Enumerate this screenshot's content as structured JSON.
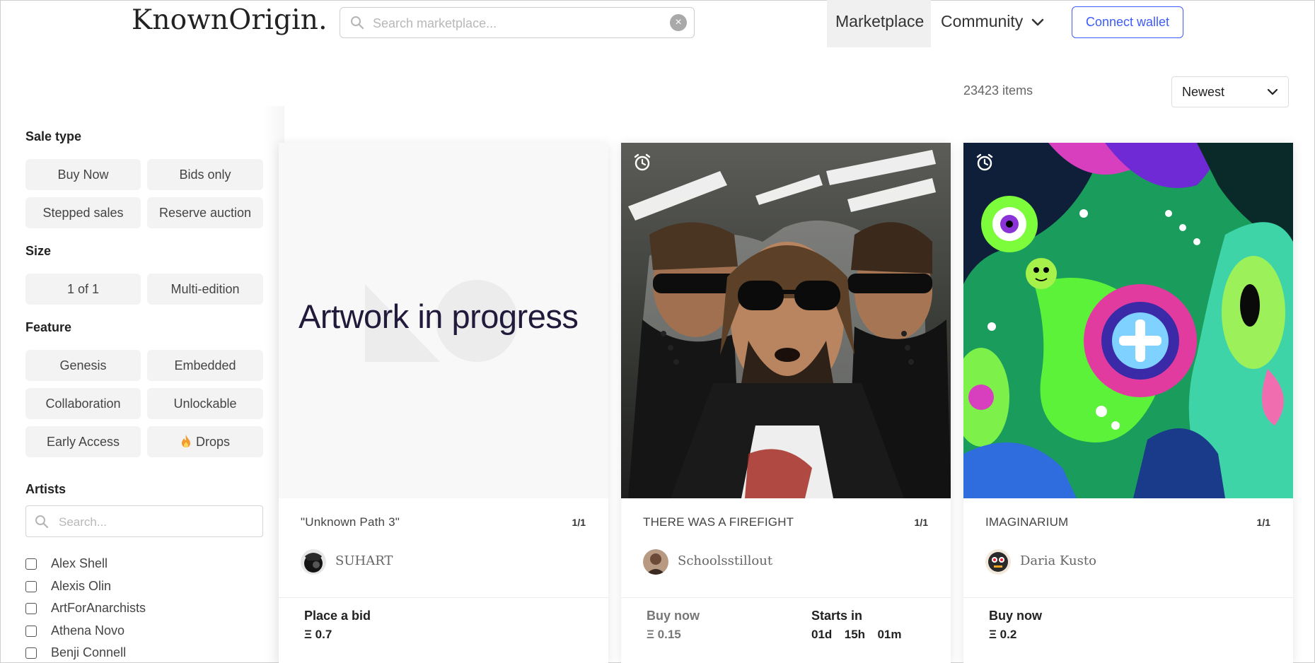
{
  "header": {
    "logo": "KnownOrigin.",
    "search_placeholder": "Search marketplace...",
    "nav_marketplace": "Marketplace",
    "nav_community": "Community",
    "connect_wallet": "Connect wallet"
  },
  "results": {
    "count": "23423 items",
    "sort_selected": "Newest"
  },
  "sidebar": {
    "sale_type": {
      "title": "Sale type",
      "options": [
        "Buy Now",
        "Bids only",
        "Stepped sales",
        "Reserve auction"
      ]
    },
    "size": {
      "title": "Size",
      "options": [
        "1 of 1",
        "Multi-edition"
      ]
    },
    "feature": {
      "title": "Feature",
      "options": [
        "Genesis",
        "Embedded",
        "Collaboration",
        "Unlockable",
        "Early Access",
        "Drops"
      ]
    },
    "artists": {
      "title": "Artists",
      "search_placeholder": "Search...",
      "list": [
        "Alex Shell",
        "Alexis Olin",
        "ArtForAnarchists",
        "Athena Novo",
        "Benji Connell"
      ]
    }
  },
  "cards": [
    {
      "art_text": "Artwork in progress",
      "title": "\"Unknown Path 3\"",
      "edition": "1/1",
      "artist": "SUHART",
      "price_label": "Place a bid",
      "price": "Ξ 0.7"
    },
    {
      "title": "THERE WAS A FIREFIGHT",
      "edition": "1/1",
      "artist": "Schoolsstillout",
      "price_label": "Buy now",
      "price": "Ξ 0.15",
      "starts_label": "Starts in",
      "starts_value": "01d  15h  01m"
    },
    {
      "title": "IMAGINARIUM",
      "edition": "1/1",
      "artist": "Daria Kusto",
      "price_label": "Buy now",
      "price": "Ξ 0.2"
    }
  ],
  "colors": {
    "accent": "#3d5bff",
    "chip_bg": "#f3f3f3",
    "nav_active_bg": "#f0f0f0"
  },
  "icons": {
    "search": "search-icon",
    "clear": "clear-icon",
    "chevron": "chevron-down-icon",
    "alarm": "alarm-clock-icon",
    "drops": "fire-icon"
  }
}
